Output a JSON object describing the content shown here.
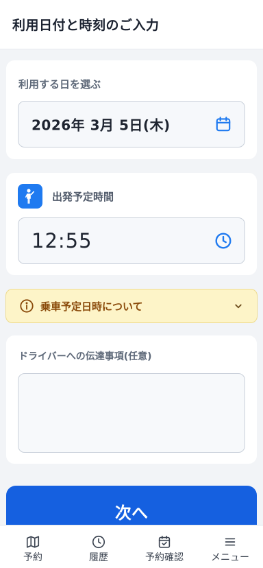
{
  "header": {
    "title": "利用日付と時刻のご入力"
  },
  "date_section": {
    "label": "利用する日を選ぶ",
    "value": "2026年 3月 5日(木)",
    "icon": "calendar-icon"
  },
  "time_section": {
    "label": "出発予定時間",
    "value": "12:55",
    "badge_icon": "person-waving-icon",
    "icon": "clock-icon"
  },
  "notice": {
    "text": "乗車予定日時について",
    "icon": "info-icon",
    "chevron": "chevron-down-icon"
  },
  "note_section": {
    "label": "ドライバーへの伝達事項(任意)",
    "value": ""
  },
  "next_button": {
    "label": "次へ"
  },
  "tabbar": {
    "items": [
      {
        "label": "予約",
        "icon": "map-icon"
      },
      {
        "label": "履歴",
        "icon": "clock-icon"
      },
      {
        "label": "予約確認",
        "icon": "calendar-check-icon"
      },
      {
        "label": "メニュー",
        "icon": "menu-icon"
      }
    ]
  },
  "colors": {
    "primary": "#1560e0",
    "accent_icon": "#1f7af0",
    "notice_bg": "#fdf4c8",
    "notice_text": "#8a4a0a"
  }
}
